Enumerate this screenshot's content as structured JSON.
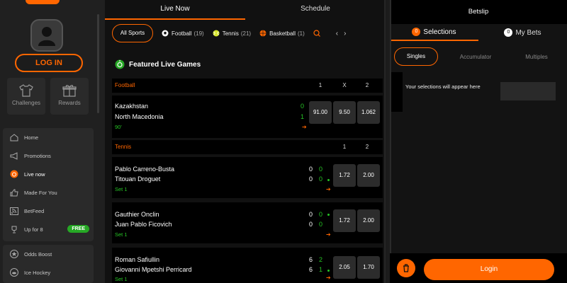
{
  "sidebar": {
    "login_label": "LOG IN",
    "tiles": [
      {
        "label": "Challenges",
        "icon": "tshirt-icon"
      },
      {
        "label": "Rewards",
        "icon": "gift-icon"
      }
    ],
    "nav_items": [
      {
        "label": "Home",
        "icon": "home-icon"
      },
      {
        "label": "Promotions",
        "icon": "megaphone-icon"
      },
      {
        "label": "Live now",
        "icon": "live-icon"
      },
      {
        "label": "Made For You",
        "icon": "thumbs-up-icon"
      },
      {
        "label": "BetFeed",
        "icon": "rss-icon"
      },
      {
        "label": "Up for 8",
        "icon": "trophy-icon",
        "badge": "FREE"
      }
    ],
    "nav_items2": [
      {
        "label": "Odds Boost",
        "icon": "star-icon"
      },
      {
        "label": "Ice Hockey",
        "icon": "puck-icon"
      }
    ]
  },
  "main": {
    "tabs": [
      {
        "label": "Live Now",
        "active": true
      },
      {
        "label": "Schedule",
        "active": false
      }
    ],
    "filters": {
      "all_label": "All Sports",
      "chips": [
        {
          "label": "Football",
          "count": "(19)",
          "icon": "football-icon"
        },
        {
          "label": "Tennis",
          "count": "(21)",
          "icon": "tennis-ball-icon"
        },
        {
          "label": "Basketball",
          "count": "(1)",
          "icon": "basketball-icon"
        }
      ],
      "prev": "‹",
      "next": "›"
    },
    "featured_title": "Featured Live Games",
    "football": {
      "header": "Football",
      "cols": [
        "1",
        "X",
        "2"
      ],
      "event": {
        "team1": "Kazakhstan",
        "team2": "North Macedonia",
        "status": "90'",
        "score1": "0",
        "score2": "1",
        "odds": [
          "91.00",
          "9.50",
          "1.062"
        ]
      }
    },
    "tennis": {
      "header": "Tennis",
      "cols": [
        "1",
        "2"
      ],
      "events": [
        {
          "team1": "Pablo Carreno-Busta",
          "team2": "Titouan Droguet",
          "status": "Set 1",
          "sets1": "0",
          "games1": "0",
          "sets2": "0",
          "games2": "0",
          "serving": 2,
          "odds": [
            "1.72",
            "2.00"
          ]
        },
        {
          "team1": "Gauthier Onclin",
          "team2": "Juan Pablo Ficovich",
          "status": "Set 1",
          "sets1": "0",
          "games1": "0",
          "sets2": "0",
          "games2": "0",
          "serving": 1,
          "odds": [
            "1.72",
            "2.00"
          ]
        },
        {
          "team1": "Roman Safiullin",
          "team2": "Giovanni Mpetshi Perricard",
          "status": "Set 1",
          "sets1": "6",
          "games1": "2",
          "sets2": "6",
          "games2": "1",
          "serving": 2,
          "odds": [
            "2.05",
            "1.70"
          ]
        }
      ]
    }
  },
  "betslip": {
    "title": "Betslip",
    "tabs": [
      {
        "count": "0",
        "label": "Selections"
      },
      {
        "count": "0",
        "label": "My Bets"
      }
    ],
    "sub_tabs": [
      "Singles",
      "Accumulator",
      "Multiples"
    ],
    "empty_message": "Your selections will appear here",
    "login_label": "Login"
  },
  "colors": {
    "accent": "#ff6600",
    "live": "#26c425",
    "badge": "#26a825"
  }
}
